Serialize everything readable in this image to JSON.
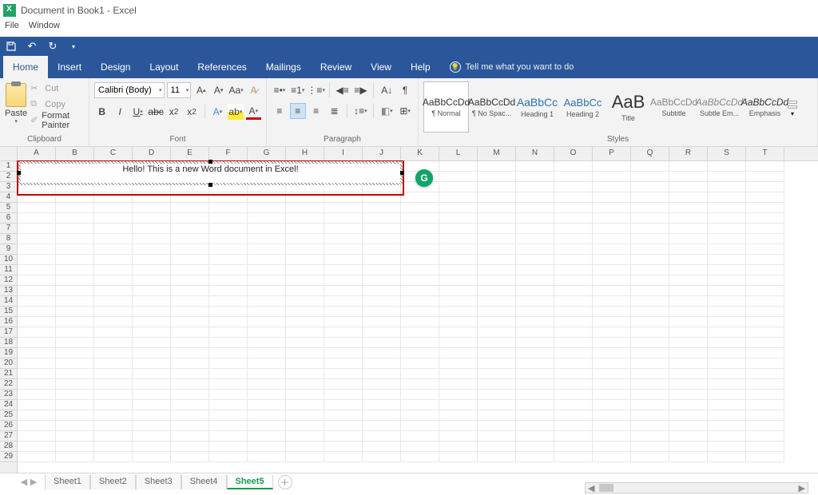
{
  "title": "Document in Book1 - Excel",
  "menubar": {
    "file": "File",
    "window": "Window"
  },
  "tabs": [
    "Home",
    "Insert",
    "Design",
    "Layout",
    "References",
    "Mailings",
    "Review",
    "View",
    "Help"
  ],
  "activeTab": "Home",
  "tellMe": "Tell me what you want to do",
  "clipboard": {
    "paste": "Paste",
    "cut": "Cut",
    "copy": "Copy",
    "formatPainter": "Format Painter",
    "label": "Clipboard"
  },
  "font": {
    "name": "Calibri (Body)",
    "size": "11",
    "label": "Font"
  },
  "paragraph": {
    "label": "Paragraph"
  },
  "styles": {
    "label": "Styles",
    "items": [
      {
        "preview": "AaBbCcDd",
        "label": "¶ Normal",
        "sel": true,
        "cls": ""
      },
      {
        "preview": "AaBbCcDd",
        "label": "¶ No Spac...",
        "sel": false,
        "cls": ""
      },
      {
        "preview": "AaBbCc",
        "label": "Heading 1",
        "sel": false,
        "cls": "h1"
      },
      {
        "preview": "AaBbCc",
        "label": "Heading 2",
        "sel": false,
        "cls": "h2"
      },
      {
        "preview": "AaB",
        "label": "Title",
        "sel": false,
        "cls": "title"
      },
      {
        "preview": "AaBbCcDd",
        "label": "Subtitle",
        "sel": false,
        "cls": "sub"
      },
      {
        "preview": "AaBbCcDd",
        "label": "Subtle Em...",
        "sel": false,
        "cls": "subem"
      },
      {
        "preview": "AaBbCcDd",
        "label": "Emphasis",
        "sel": false,
        "cls": "em"
      }
    ]
  },
  "columns": [
    "A",
    "B",
    "C",
    "D",
    "E",
    "F",
    "G",
    "H",
    "I",
    "J",
    "K",
    "L",
    "M",
    "N",
    "O",
    "P",
    "Q",
    "R",
    "S",
    "T"
  ],
  "rowCount": 29,
  "embeddedText": "Hello! This is a new Word document in Excel!",
  "sheetTabs": [
    "Sheet1",
    "Sheet2",
    "Sheet3",
    "Sheet4",
    "Sheet5"
  ],
  "activeSheet": "Sheet5",
  "colors": {
    "ribbon": "#2b579a",
    "selection": "#c00000",
    "sheetActive": "#169b4c"
  }
}
